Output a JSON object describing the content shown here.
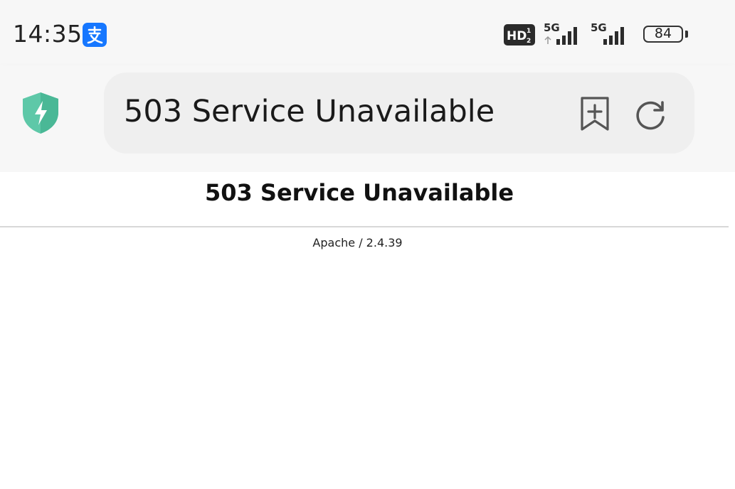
{
  "status_bar": {
    "time": "14:35",
    "app_icon": "alipay-icon",
    "network_1": "5G",
    "network_2": "5G",
    "battery": "84"
  },
  "toolbar": {
    "security_icon": "shield-bolt-icon",
    "address_text": "503 Service Unavailable",
    "bookmark_icon": "add-bookmark-icon",
    "reload_icon": "reload-icon",
    "accent_color": "#4fc3a1"
  },
  "page": {
    "title": "503 Service Unavailable",
    "signature": "Apache / 2.4.39"
  }
}
